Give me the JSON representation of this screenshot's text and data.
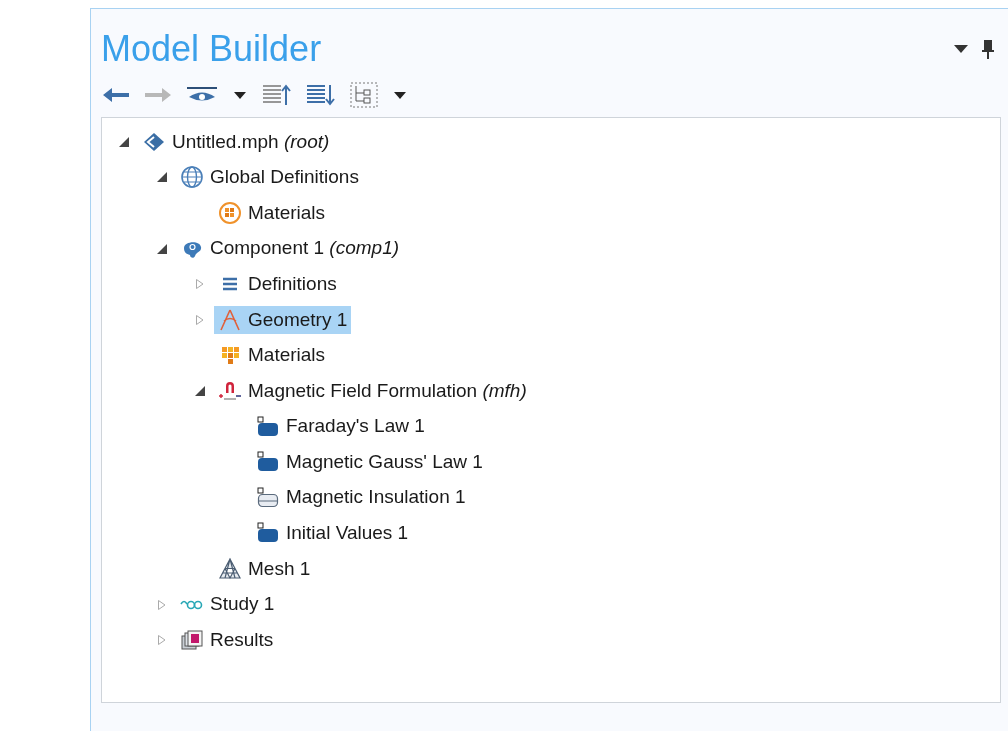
{
  "panel": {
    "title": "Model Builder"
  },
  "toolbar": [
    {
      "kind": "back",
      "disabled": false
    },
    {
      "kind": "forward",
      "disabled": true
    },
    {
      "kind": "show",
      "disabled": false
    },
    {
      "kind": "dropdown",
      "disabled": false
    },
    {
      "kind": "collapse",
      "disabled": false
    },
    {
      "kind": "expand",
      "disabled": false
    },
    {
      "kind": "tree",
      "disabled": false
    },
    {
      "kind": "dropdown",
      "disabled": false
    }
  ],
  "tree": [
    {
      "label": "Untitled.mph *(root)*",
      "kind": "file",
      "expanded": true,
      "selected": false,
      "children": [
        {
          "label": "Global Definitions",
          "kind": "globe",
          "expanded": true,
          "selected": false,
          "children": [
            {
              "label": "Materials",
              "kind": "materials-ring",
              "selected": false
            }
          ]
        },
        {
          "label": "Component 1 *(comp1)*",
          "kind": "component",
          "expanded": true,
          "selected": false,
          "children": [
            {
              "label": "Definitions",
              "kind": "list",
              "expanded": false,
              "selected": false
            },
            {
              "label": "Geometry 1",
              "kind": "geometry",
              "expanded": false,
              "selected": true
            },
            {
              "label": "Materials",
              "kind": "materials",
              "selected": false
            },
            {
              "label": "Magnetic Field Formulation *(mfh)*",
              "kind": "physics",
              "expanded": true,
              "selected": false,
              "children": [
                {
                  "label": "Faraday's Law 1",
                  "kind": "domain",
                  "selected": false
                },
                {
                  "label": "Magnetic Gauss' Law 1",
                  "kind": "domain",
                  "selected": false
                },
                {
                  "label": "Magnetic Insulation 1",
                  "kind": "boundary",
                  "selected": false
                },
                {
                  "label": "Initial Values 1",
                  "kind": "domain",
                  "selected": false
                }
              ]
            },
            {
              "label": "Mesh 1",
              "kind": "mesh",
              "selected": false
            }
          ]
        },
        {
          "label": "Study 1",
          "kind": "study",
          "expanded": false,
          "selected": false
        },
        {
          "label": "Results",
          "kind": "results",
          "expanded": false,
          "selected": false
        }
      ]
    }
  ]
}
